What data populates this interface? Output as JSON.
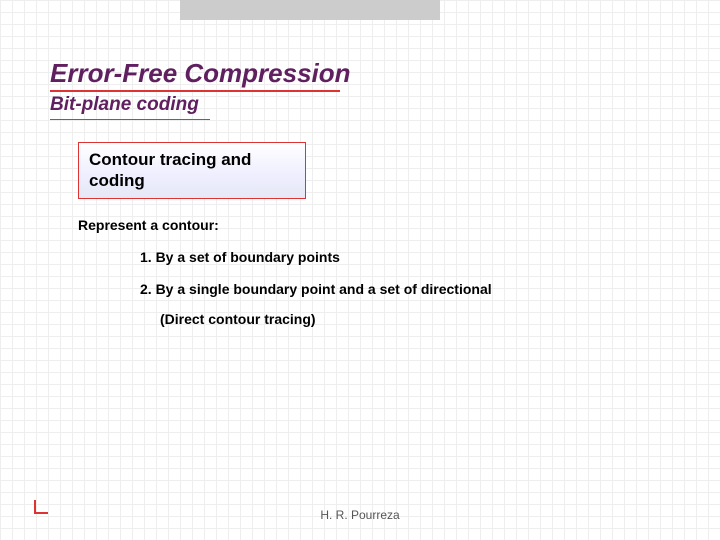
{
  "title": "Error-Free Compression",
  "subtitle": "Bit-plane coding",
  "box": "Contour tracing and coding",
  "lead": "Represent a contour:",
  "items": [
    "1. By a set of boundary points",
    "2. By a single boundary point and a set of directional"
  ],
  "sub": "(Direct contour tracing)",
  "footer": "H. R. Pourreza"
}
